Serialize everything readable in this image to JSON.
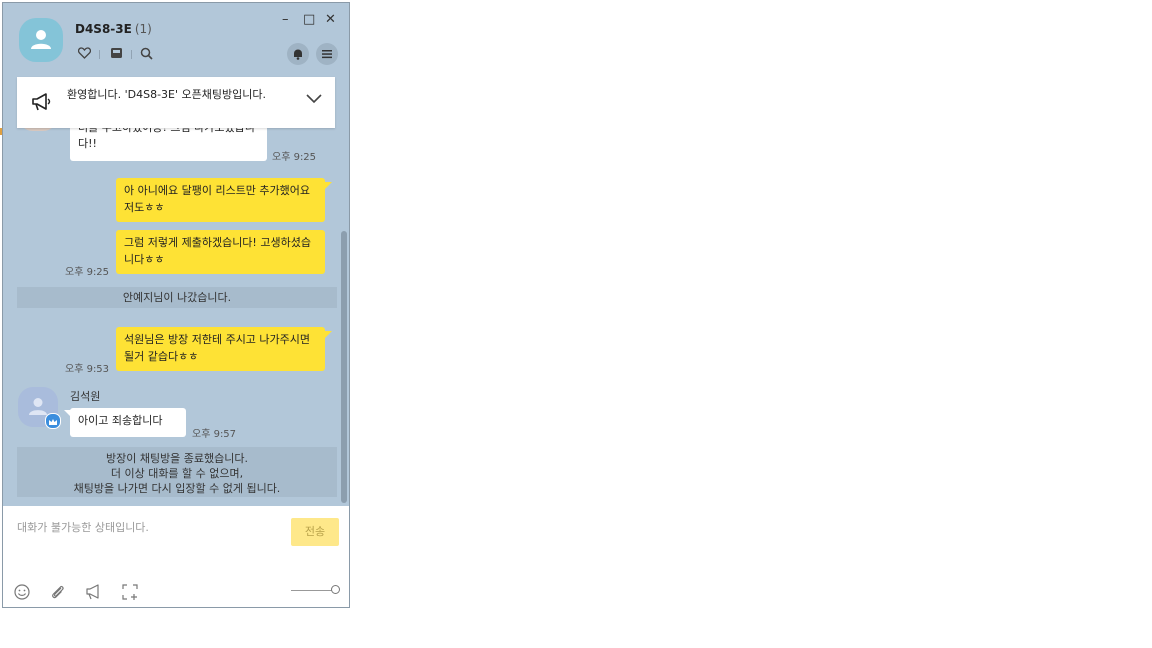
{
  "header": {
    "title": "D4S8-3E",
    "member_count": "(1)",
    "minimize_glyph": "–",
    "maximize_glyph": "□",
    "close_glyph": "✕"
  },
  "notice": {
    "text": "환영합니다. 'D4S8-3E' 오픈채팅방입니다."
  },
  "messages": {
    "m0_text": "너를 주고하였어용! 그럼 나가보겠습니다!!",
    "m0_time": "오후 9:25",
    "m1_text": "아 아니에요 달팽이 리스트만 추가했어요 저도ㅎㅎ",
    "m2_text": "그럼 저렇게 제출하겠습니다! 고생하셨습니다ㅎㅎ",
    "m2_time": "오후 9:25",
    "sys1": "안예지님이 나갔습니다.",
    "m3_text": "석원님은 방장 저한테 주시고 나가주시면 될거 같습다ㅎㅎ",
    "m3_time": "오후 9:53",
    "m4_sender": "김석원",
    "m4_text": "아이고 죄송합니다",
    "m4_time": "오후 9:57",
    "sys2_line1": "방장이 채팅방을 종료했습니다.",
    "sys2_line2": "더 이상 대화를 할 수 없으며,",
    "sys2_line3": "채팅방을 나가면 다시 입장할 수 없게 됩니다."
  },
  "input": {
    "placeholder": "대화가 불가능한 상태입니다.",
    "send_label": "전송"
  },
  "colors": {
    "chat_bg": "#b2c7d9",
    "my_bubble": "#fee235",
    "other_bubble": "#ffffff",
    "send_disabled": "#fee88a"
  },
  "icons": [
    "person-icon",
    "heart-icon",
    "inbox-icon",
    "search-icon",
    "bell-icon",
    "menu-icon",
    "megaphone-icon",
    "chevron-down-icon",
    "emoji-icon",
    "attach-icon",
    "announce-icon",
    "capture-icon",
    "crown-icon"
  ]
}
